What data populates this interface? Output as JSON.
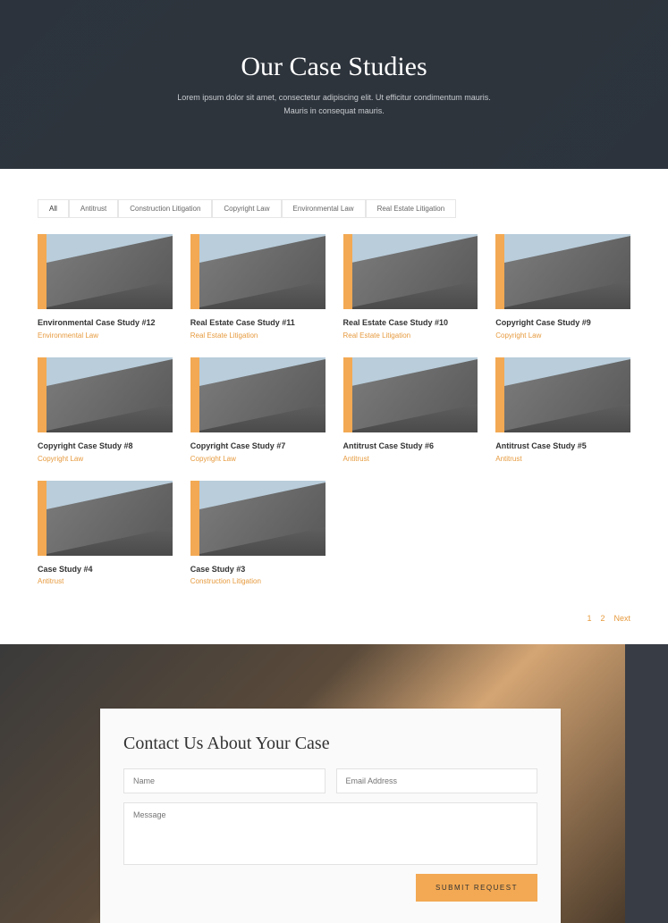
{
  "hero": {
    "title": "Our Case Studies",
    "subtitle": "Lorem ipsum dolor sit amet, consectetur adipiscing elit. Ut efficitur condimentum mauris. Mauris in consequat mauris."
  },
  "filters": [
    {
      "label": "All",
      "active": true
    },
    {
      "label": "Antitrust",
      "active": false
    },
    {
      "label": "Construction Litigation",
      "active": false
    },
    {
      "label": "Copyright Law",
      "active": false
    },
    {
      "label": "Environmental Law",
      "active": false
    },
    {
      "label": "Real Estate Litigation",
      "active": false
    }
  ],
  "cases": [
    {
      "title": "Environmental Case Study #12",
      "category": "Environmental Law"
    },
    {
      "title": "Real Estate Case Study #11",
      "category": "Real Estate Litigation"
    },
    {
      "title": "Real Estate Case Study #10",
      "category": "Real Estate Litigation"
    },
    {
      "title": "Copyright Case Study #9",
      "category": "Copyright Law"
    },
    {
      "title": "Copyright Case Study #8",
      "category": "Copyright Law"
    },
    {
      "title": "Copyright Case Study #7",
      "category": "Copyright Law"
    },
    {
      "title": "Antitrust Case Study #6",
      "category": "Antitrust"
    },
    {
      "title": "Antitrust Case Study #5",
      "category": "Antitrust"
    },
    {
      "title": "Case Study #4",
      "category": "Antitrust"
    },
    {
      "title": "Case Study #3",
      "category": "Construction Litigation"
    }
  ],
  "pagination": {
    "p1": "1",
    "p2": "2",
    "next": "Next"
  },
  "contact": {
    "heading": "Contact Us About Your Case",
    "name_ph": "Name",
    "email_ph": "Email Address",
    "message_ph": "Message",
    "submit": "SUBMIT REQUEST"
  },
  "colors": {
    "accent": "#f3a953",
    "link": "#e69a3e"
  }
}
